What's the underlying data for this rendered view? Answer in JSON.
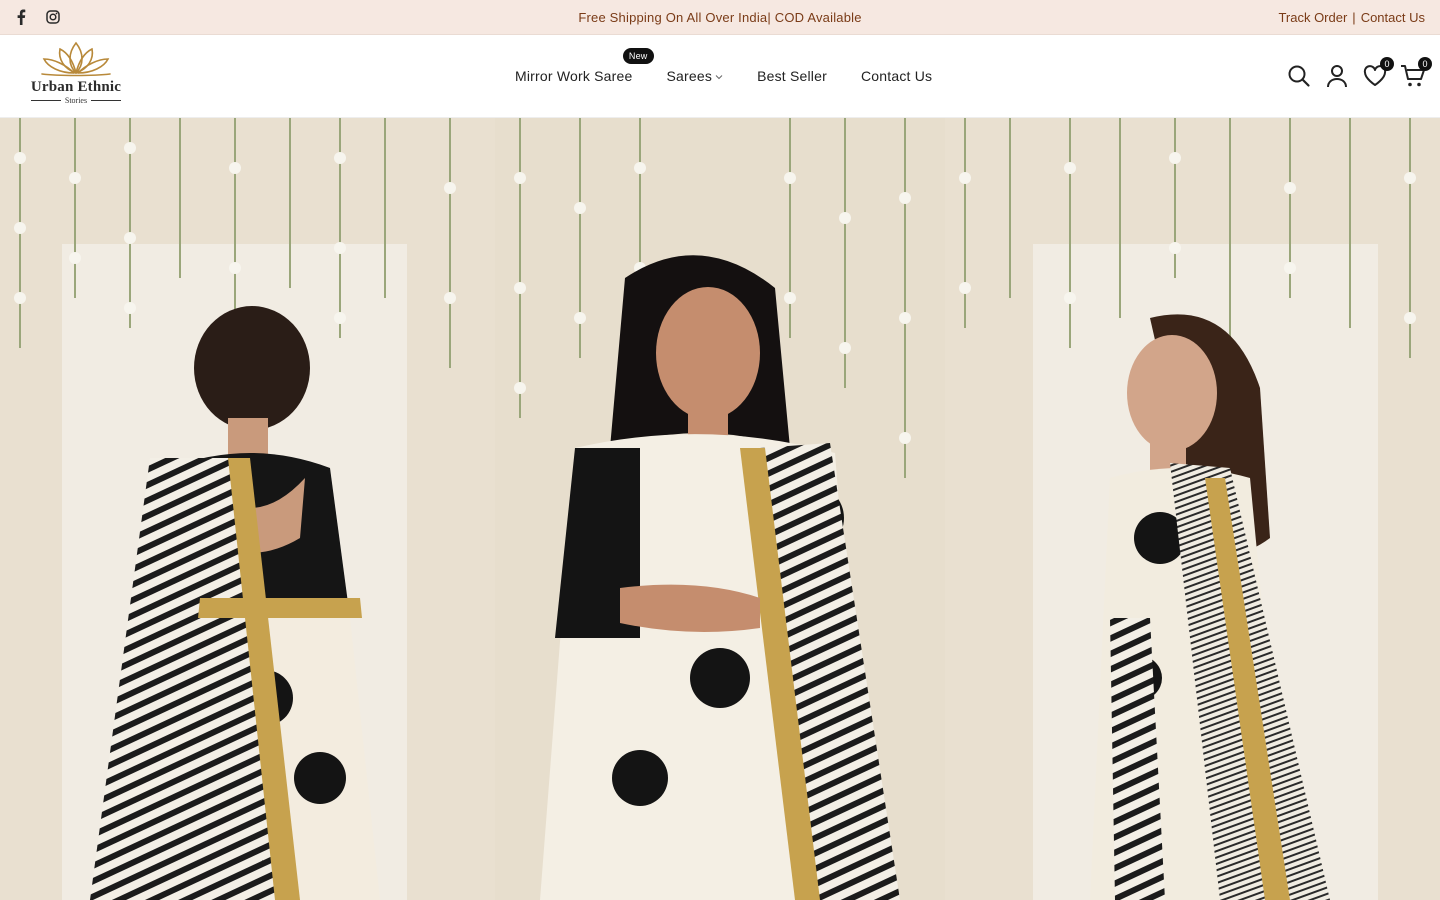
{
  "topbar": {
    "social": [
      {
        "name": "facebook-icon"
      },
      {
        "name": "instagram-icon"
      }
    ],
    "announcement": "Free Shipping On All Over India| COD Available",
    "links": {
      "track_order": "Track Order",
      "separator": "|",
      "contact_us": "Contact Us"
    }
  },
  "header": {
    "logo": {
      "brand": "Urban Ethnic",
      "sub": "Stories"
    },
    "nav": [
      {
        "label": "Mirror Work Saree",
        "badge": "New"
      },
      {
        "label": "Sarees",
        "has_dropdown": true
      },
      {
        "label": "Best Seller"
      },
      {
        "label": "Contact Us"
      }
    ],
    "icons": {
      "search": "search-icon",
      "account": "user-icon",
      "wishlist": "heart-icon",
      "wishlist_count": "0",
      "cart": "cart-icon",
      "cart_count": "0"
    }
  },
  "colors": {
    "topbar_bg": "#f6e8e1",
    "topbar_text": "#7a3b17",
    "badge_bg": "#111111",
    "logo_gold": "#b8893a"
  }
}
